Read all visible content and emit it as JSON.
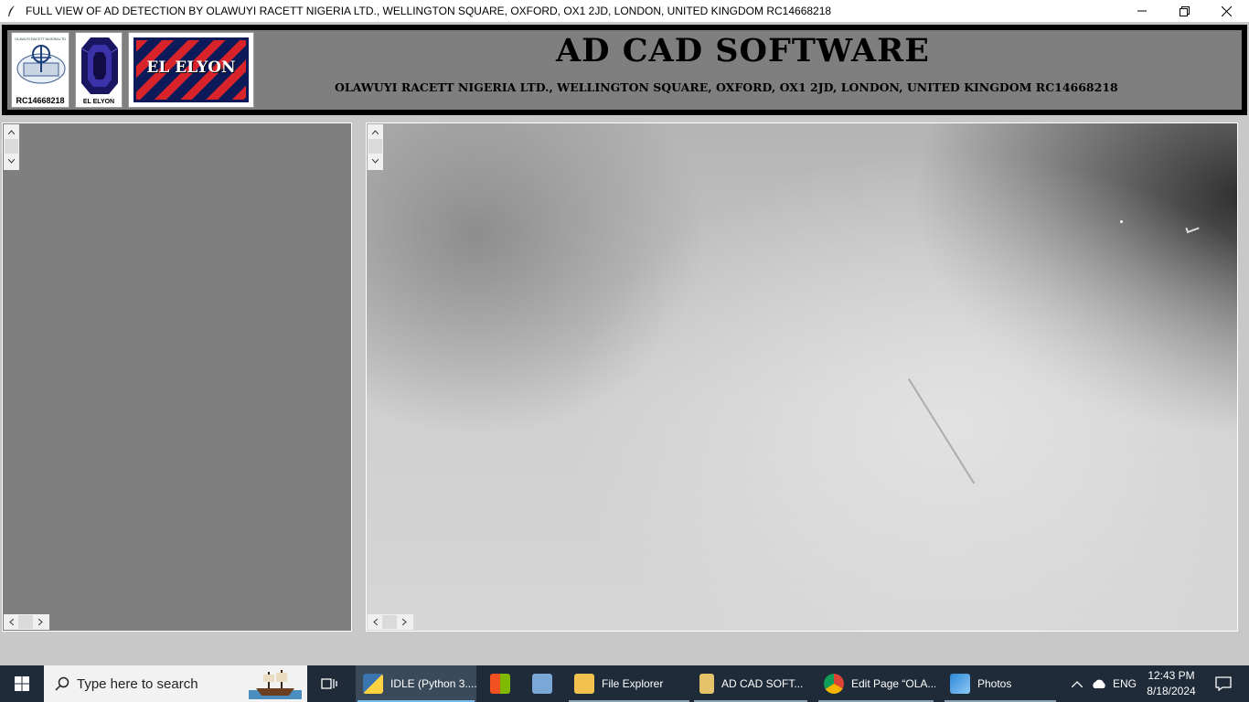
{
  "window": {
    "title": "FULL VIEW OF AD DETECTION BY OLAWUYI RACETT NIGERIA LTD., WELLINGTON SQUARE, OXFORD, OX1 2JD, LONDON, UNITED KINGDOM RC14668218",
    "minimize_icon": "minimize-icon",
    "maximize_icon": "restore-icon",
    "close_icon": "close-icon"
  },
  "header": {
    "logo1_small_text": "OLAWUYI RACETT NIGERIA LTD",
    "logo1_rc": "RC14668218",
    "logo2_label": "EL ELYON",
    "logo3_text": "EL ELYON",
    "title": "AD CAD SOFTWARE",
    "subtitle": "OLAWUYI RACETT NIGERIA LTD., WELLINGTON SQUARE, OXFORD, OX1 2JD, LONDON, UNITED KINGDOM RC14668218"
  },
  "panels": {
    "left_background": "#7f7f7f",
    "right_content": "mammogram-image"
  },
  "taskbar": {
    "search_placeholder": "Type here to search",
    "apps": [
      {
        "label": "IDLE (Python 3....",
        "icon": "python-icon",
        "active": true
      },
      {
        "label": "",
        "icon": "microsoft-store-icon"
      },
      {
        "label": "",
        "icon": "keyboard-app-icon"
      },
      {
        "label": "File Explorer",
        "icon": "folder-icon"
      },
      {
        "label": "AD CAD SOFT...",
        "icon": "file-icon"
      },
      {
        "label": "Edit Page “OLA...",
        "icon": "chrome-icon"
      },
      {
        "label": "Photos",
        "icon": "photos-icon"
      }
    ],
    "language": "ENG",
    "time": "12:43 PM",
    "date": "8/18/2024"
  },
  "colors": {
    "taskbar": "#1f2b38",
    "accent": "#76b9ed",
    "logo_red": "#d8232a",
    "logo_navy": "#0c1a5a"
  }
}
